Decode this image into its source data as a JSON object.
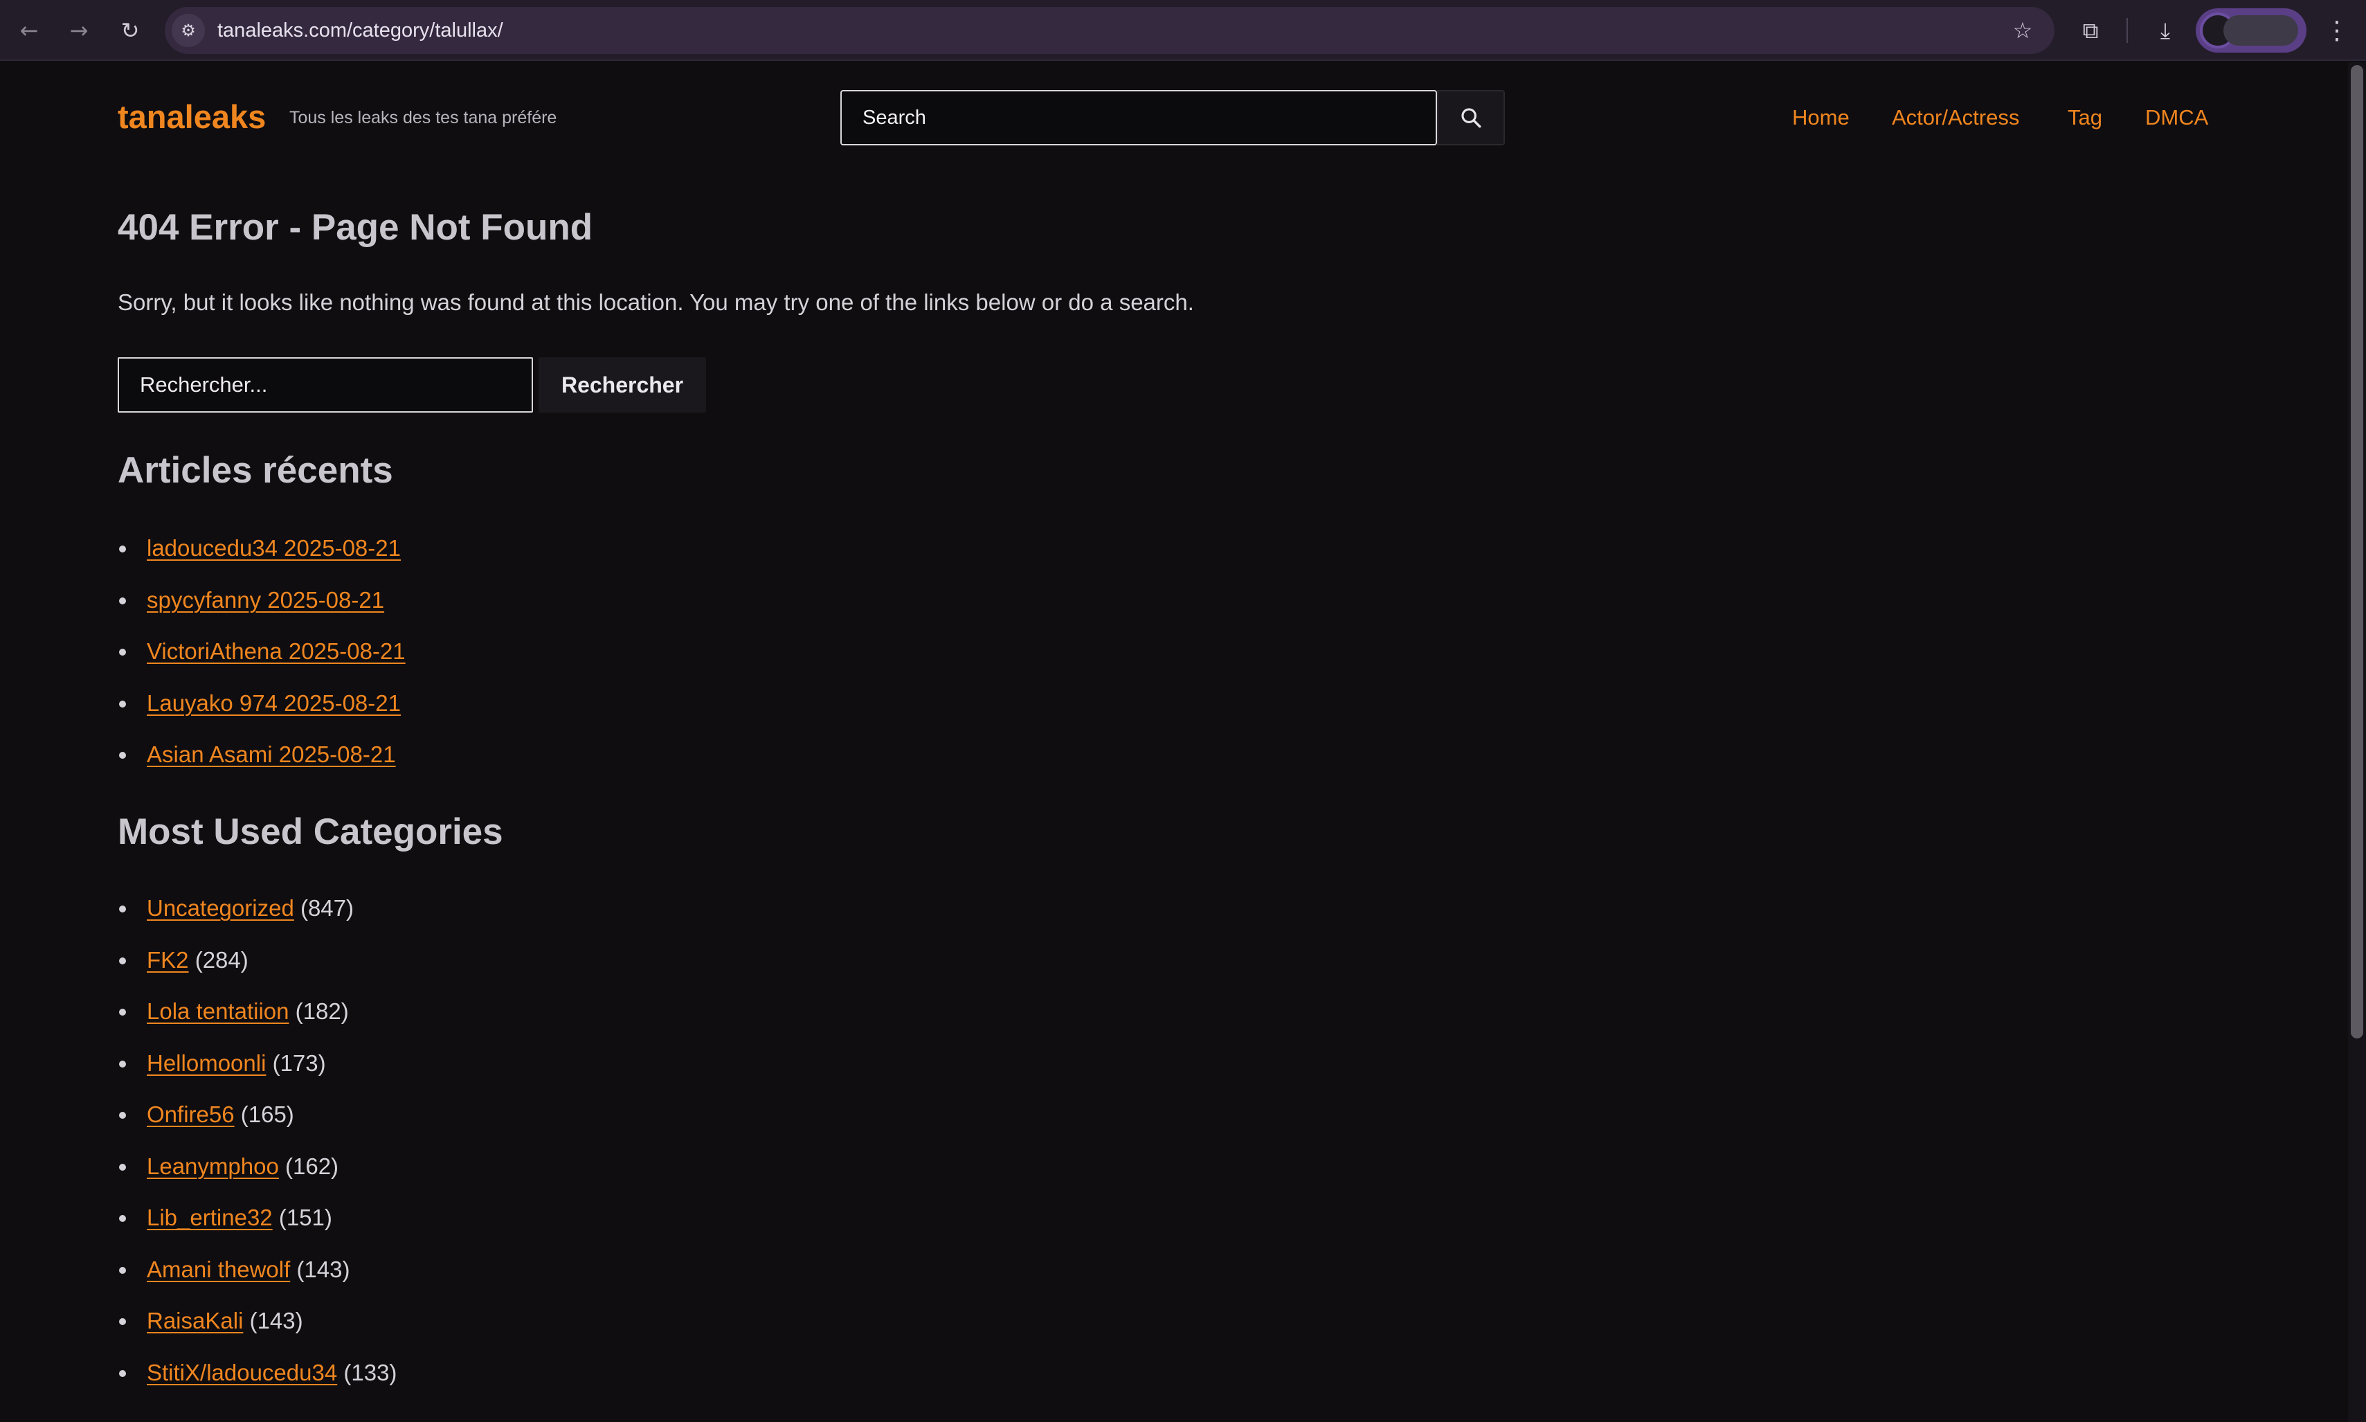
{
  "browser": {
    "back_icon": "←",
    "forward_icon": "→",
    "reload_icon": "↻",
    "site_info_icon": "⚙",
    "url": "tanaleaks.com/category/talullax/",
    "bookmark_icon": "☆",
    "extensions_icon": "⧉",
    "download_icon": "⤓",
    "menu_icon": "⋮"
  },
  "header": {
    "logo": "tanaleaks",
    "tagline": "Tous les leaks des tes tana préfére",
    "search_placeholder": "Search",
    "nav": [
      {
        "label": "Home"
      },
      {
        "label": "Actor/Actress"
      },
      {
        "label": "Tag"
      },
      {
        "label": "DMCA"
      }
    ]
  },
  "main": {
    "title": "404 Error - Page Not Found",
    "message": "Sorry, but it looks like nothing was found at this location. You may try one of the links below or do a search.",
    "search_placeholder": "Rechercher...",
    "search_button": "Rechercher",
    "recent_heading": "Articles récents",
    "recent_posts": [
      {
        "label": "ladoucedu34 2025-08-21"
      },
      {
        "label": "spycyfanny 2025-08-21"
      },
      {
        "label": "VictoriAthena 2025-08-21"
      },
      {
        "label": "Lauyako 974 2025-08-21"
      },
      {
        "label": "Asian Asami 2025-08-21"
      }
    ],
    "categories_heading": "Most Used Categories",
    "categories": [
      {
        "label": "Uncategorized",
        "count": "(847)"
      },
      {
        "label": "FK2",
        "count": "(284)"
      },
      {
        "label": "Lola tentatiion",
        "count": "(182)"
      },
      {
        "label": "Hellomoonli",
        "count": "(173)"
      },
      {
        "label": "Onfire56",
        "count": "(165)"
      },
      {
        "label": "Leanymphoo",
        "count": "(162)"
      },
      {
        "label": "Lib_ertine32",
        "count": "(151)"
      },
      {
        "label": "Amani thewolf",
        "count": "(143)"
      },
      {
        "label": "RaisaKali",
        "count": "(143)"
      },
      {
        "label": "StitiX/ladoucedu34",
        "count": "(133)"
      }
    ]
  },
  "colors": {
    "accent": "#f0861f",
    "background": "#0f0d10",
    "heading": "#c9c5cc",
    "body_text": "#d6d2d9",
    "browser_bar": "#231d2a"
  }
}
